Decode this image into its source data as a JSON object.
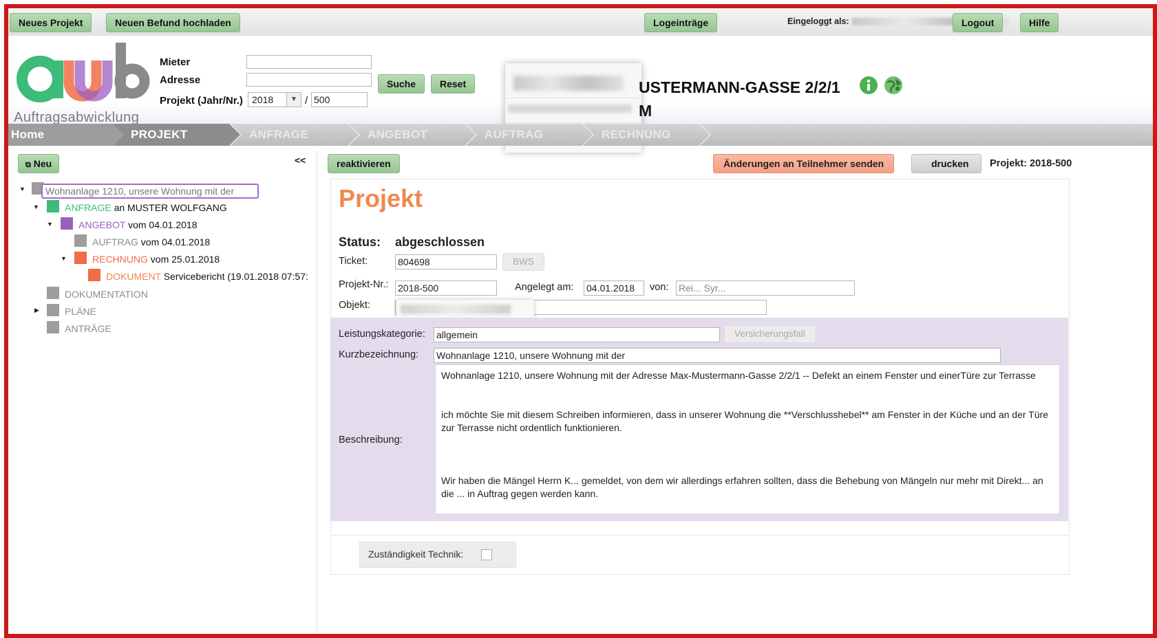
{
  "topbar": {
    "new_project": "Neues Projekt",
    "upload": "Neuen Befund hochladen",
    "logs": "Logeinträge",
    "logged_in_as": "Eingeloggt als:",
    "logout": "Logout",
    "help": "Hilfe"
  },
  "logo": {
    "subtitle": "Auftragsabwicklung"
  },
  "search": {
    "tenant_label": "Mieter",
    "address_label": "Adresse",
    "project_label": "Projekt (Jahr/Nr.)",
    "year": "2018",
    "separator": "/",
    "number": "500",
    "search_button": "Suche",
    "reset_button": "Reset"
  },
  "header": {
    "address_line1": "USTERMANN-GASSE 2/2/1",
    "address_line2": "M"
  },
  "nav": {
    "home": "Home",
    "projekt": "PROJEKT",
    "anfrage": "ANFRAGE",
    "angebot": "ANGEBOT",
    "auftrag": "AUFTRAG",
    "rechnung": "RECHNUNG"
  },
  "left": {
    "new_button": "Neu",
    "collapse": "<<",
    "tree": {
      "root": "Wohnanlage 1210, unsere Wohnung mit der",
      "anfrage_tag": "ANFRAGE",
      "anfrage_text": " an MUSTER WOLFGANG",
      "angebot_tag": "ANGEBOT",
      "angebot_text": " vom 04.01.2018",
      "auftrag_tag": "AUFTRAG",
      "auftrag_text": " vom 04.01.2018",
      "rechnung_tag": "RECHNUNG",
      "rechnung_text": " vom 25.01.2018",
      "dokument_tag": "DOKUMENT",
      "dokument_text": " Servicebericht (19.01.2018 07:57:",
      "dokumentation": "DOKUMENTATION",
      "plaene": "PLÄNE",
      "antraege": "ANTRÄGE"
    }
  },
  "toolbar": {
    "reactivate": "reaktivieren",
    "send_changes": "Änderungen an Teilnehmer senden",
    "print": "drucken",
    "project_ref": "Projekt: 2018-500"
  },
  "project": {
    "title": "Projekt",
    "status_label": "Status:",
    "status_value": "abgeschlossen",
    "ticket_label": "Ticket:",
    "ticket_value": "804698",
    "bws_button": "BWS",
    "projnr_label": "Projekt-Nr.:",
    "projnr_value": "2018-500",
    "created_label": "Angelegt am:",
    "created_value": "04.01.2018",
    "by_label": "von:",
    "by_value": "Rei... Syr...",
    "object_label": "Objekt:",
    "category_label": "Leistungskategorie:",
    "category_value": "allgemein",
    "insurance_button": "Versicherungsfall",
    "short_label": "Kurzbezeichnung:",
    "short_value": "Wohnanlage 1210, unsere  Wohnung mit der",
    "desc_label": "Beschreibung:",
    "desc_p1": "Wohnanlage 1210, unsere Wohnung mit der Adresse Max-Mustermann-Gasse 2/2/1 -- Defekt an einem Fenster und einerTüre zur Terrasse",
    "desc_p2": "ich möchte Sie mit diesem Schreiben informieren, dass in unserer Wohnung die **Verschlusshebel** am Fenster in der Küche und an der Türe zur Terrasse nicht ordentlich funktionieren.",
    "desc_p3": "Wir haben die Mängel Herrn K... gemeldet, von dem wir allerdings erfahren sollten, dass die Behebung von Mängeln nur mehr mit Direkt... an die ... in Auftrag gegen werden kann.",
    "tech_label": "Zuständigkeit Technik:"
  },
  "colors": {
    "frame": "#cc1818",
    "green_button": "#a7d0a2",
    "accent_orange": "#f0874e",
    "anfrage": "#3dbb78",
    "angebot": "#9b5fc0",
    "rechnung": "#f06c48",
    "panel_purple": "#e4dbed"
  }
}
